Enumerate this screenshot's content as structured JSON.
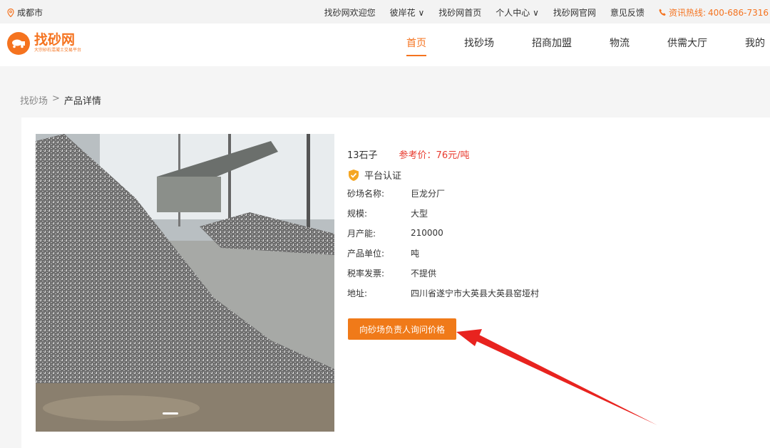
{
  "topbar": {
    "city": "成都市",
    "links": [
      "找砂网欢迎您",
      "彼岸花 ∨",
      "找砂网首页",
      "个人中心 ∨",
      "找砂网官网",
      "意见反馈"
    ],
    "hotline_label": "资讯热线:",
    "hotline_number": "400-686-7316"
  },
  "header": {
    "logo_title": "找砂网",
    "logo_subtitle": "大宗砂石混凝土交易平台",
    "nav": [
      "首页",
      "找砂场",
      "招商加盟",
      "物流",
      "供需大厅",
      "我的"
    ]
  },
  "breadcrumb": {
    "parent": "找砂场",
    "separator": ">",
    "current": "产品详情"
  },
  "product": {
    "name": "13石子",
    "price": "参考价：76元/吨",
    "cert_label": "平台认证",
    "fields": [
      {
        "key": "砂场名称:",
        "value": "巨龙分厂"
      },
      {
        "key": "规模:",
        "value": "大型"
      },
      {
        "key": "月产能:",
        "value": "210000"
      },
      {
        "key": "产品单位:",
        "value": "吨"
      },
      {
        "key": "税率发票:",
        "value": "不提供"
      },
      {
        "key": "地址:",
        "value": "四川省遂宁市大英县大英县窑垭村"
      }
    ],
    "inquiry_button": "向砂场负责人询问价格"
  },
  "colors": {
    "accent": "#f5731f",
    "price": "#e83a2e",
    "arrow": "#e8231f"
  },
  "icons": {
    "location": "location-pin-icon",
    "phone": "phone-icon",
    "verified": "shield-check-icon"
  }
}
